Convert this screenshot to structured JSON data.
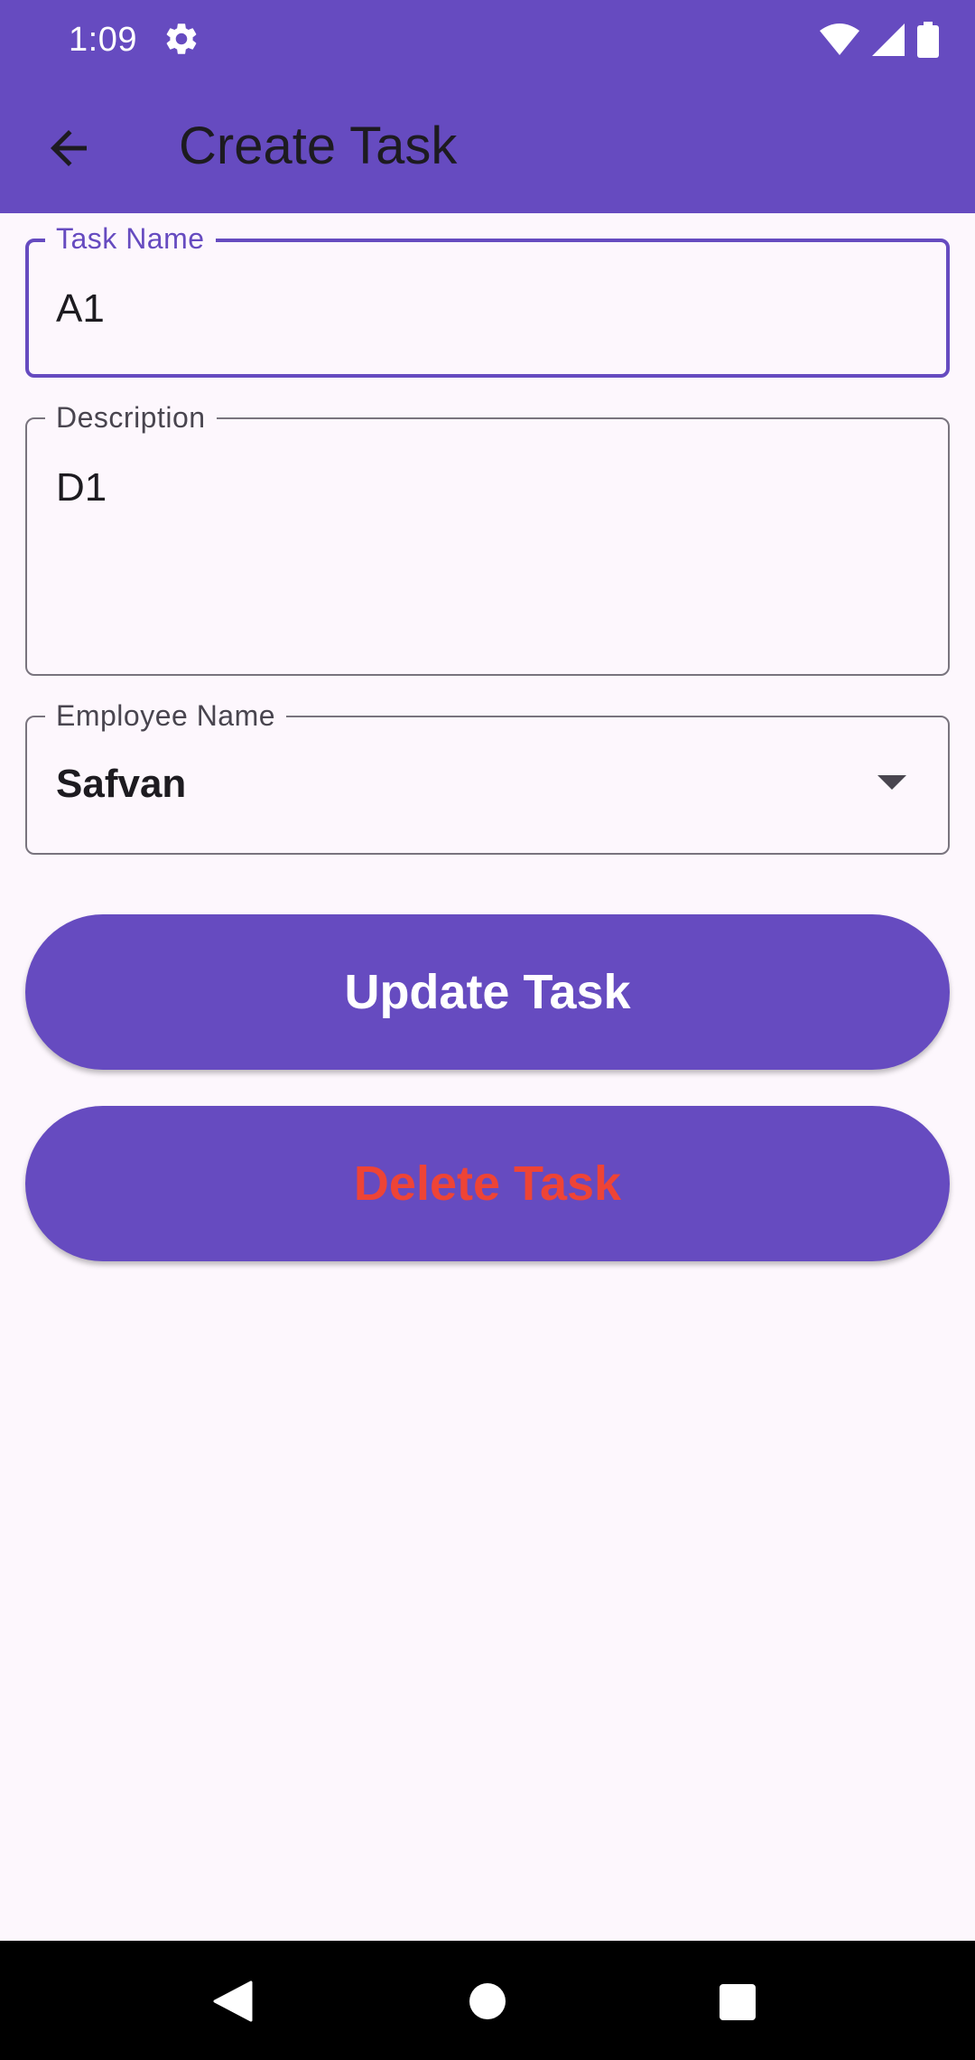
{
  "status_bar": {
    "time": "1:09",
    "icons": [
      "gear-icon",
      "wifi-icon",
      "signal-icon",
      "battery-icon"
    ]
  },
  "app_bar": {
    "title": "Create Task",
    "back_icon": "arrow-left-icon"
  },
  "form": {
    "task_name": {
      "label": "Task Name",
      "value": "A1"
    },
    "description": {
      "label": "Description",
      "value": "D1"
    },
    "employee_name": {
      "label": "Employee Name",
      "value": "Safvan",
      "icon": "dropdown-arrow-icon"
    }
  },
  "buttons": {
    "update_label": "Update Task",
    "delete_label": "Delete Task"
  },
  "nav_bar": {
    "icons": [
      "back-triangle-icon",
      "home-circle-icon",
      "recents-square-icon"
    ]
  },
  "colors": {
    "primary": "#664BC0",
    "background": "#FDF7FD",
    "on_primary": "#FFFFFF",
    "delete_text": "#EE4436",
    "outline": "#79747E",
    "text": "#1D1B20"
  }
}
